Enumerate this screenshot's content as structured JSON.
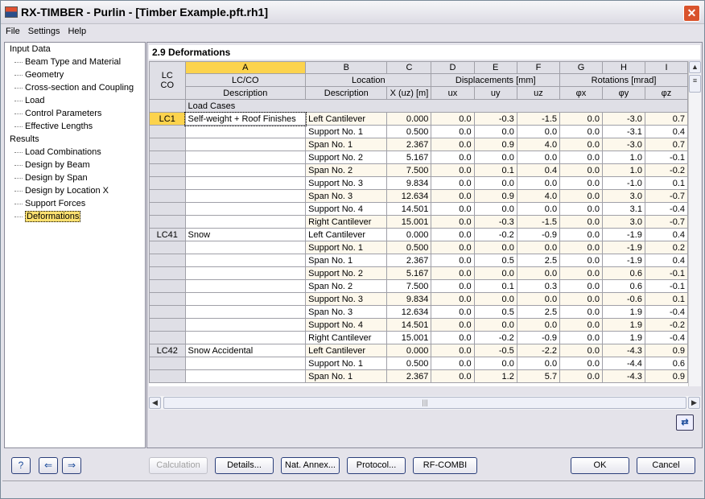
{
  "window": {
    "title": "RX-TIMBER - Purlin - [Timber Example.pft.rh1]"
  },
  "menu": [
    "File",
    "Settings",
    "Help"
  ],
  "tree": [
    {
      "label": "Input Data",
      "level": 0
    },
    {
      "label": "Beam Type and Material",
      "level": 1
    },
    {
      "label": "Geometry",
      "level": 1
    },
    {
      "label": "Cross-section and Coupling",
      "level": 1
    },
    {
      "label": "Load",
      "level": 1
    },
    {
      "label": "Control Parameters",
      "level": 1
    },
    {
      "label": "Effective Lengths",
      "level": 1
    },
    {
      "label": "Results",
      "level": 0
    },
    {
      "label": "Load Combinations",
      "level": 1
    },
    {
      "label": "Design by Beam",
      "level": 1
    },
    {
      "label": "Design by Span",
      "level": 1
    },
    {
      "label": "Design by Location X",
      "level": 1
    },
    {
      "label": "Support Forces",
      "level": 1
    },
    {
      "label": "Deformations",
      "level": 1,
      "selected": true
    }
  ],
  "section_title": "2.9 Deformations",
  "grid": {
    "col_letters": [
      "A",
      "B",
      "C",
      "D",
      "E",
      "F",
      "G",
      "H",
      "I"
    ],
    "rowhead_label1": "LC",
    "rowhead_label2": "CO",
    "group_lcco": "LC/CO",
    "group_location": "Location",
    "group_disp": "Displacements [mm]",
    "group_rot": "Rotations [mrad]",
    "sub_headers": [
      "Description",
      "Description",
      "X (uz) [m]",
      "ux",
      "uy",
      "uz",
      "φx",
      "φy",
      "φz"
    ],
    "section_row": "Load Cases",
    "rows": [
      [
        "LC1",
        "Self-weight + Roof Finishes",
        "Left Cantilever",
        "0.000",
        "0.0",
        "-0.3",
        "-1.5",
        "0.0",
        "-3.0",
        "0.7"
      ],
      [
        "",
        "",
        "Support No. 1",
        "0.500",
        "0.0",
        "0.0",
        "0.0",
        "0.0",
        "-3.1",
        "0.4"
      ],
      [
        "",
        "",
        "Span No. 1",
        "2.367",
        "0.0",
        "0.9",
        "4.0",
        "0.0",
        "-3.0",
        "0.7"
      ],
      [
        "",
        "",
        "Support No. 2",
        "5.167",
        "0.0",
        "0.0",
        "0.0",
        "0.0",
        "1.0",
        "-0.1"
      ],
      [
        "",
        "",
        "Span No. 2",
        "7.500",
        "0.0",
        "0.1",
        "0.4",
        "0.0",
        "1.0",
        "-0.2"
      ],
      [
        "",
        "",
        "Support No. 3",
        "9.834",
        "0.0",
        "0.0",
        "0.0",
        "0.0",
        "-1.0",
        "0.1"
      ],
      [
        "",
        "",
        "Span No. 3",
        "12.634",
        "0.0",
        "0.9",
        "4.0",
        "0.0",
        "3.0",
        "-0.7"
      ],
      [
        "",
        "",
        "Support No. 4",
        "14.501",
        "0.0",
        "0.0",
        "0.0",
        "0.0",
        "3.1",
        "-0.4"
      ],
      [
        "",
        "",
        "Right Cantilever",
        "15.001",
        "0.0",
        "-0.3",
        "-1.5",
        "0.0",
        "3.0",
        "-0.7"
      ],
      [
        "LC41",
        "Snow",
        "Left Cantilever",
        "0.000",
        "0.0",
        "-0.2",
        "-0.9",
        "0.0",
        "-1.9",
        "0.4"
      ],
      [
        "",
        "",
        "Support No. 1",
        "0.500",
        "0.0",
        "0.0",
        "0.0",
        "0.0",
        "-1.9",
        "0.2"
      ],
      [
        "",
        "",
        "Span No. 1",
        "2.367",
        "0.0",
        "0.5",
        "2.5",
        "0.0",
        "-1.9",
        "0.4"
      ],
      [
        "",
        "",
        "Support No. 2",
        "5.167",
        "0.0",
        "0.0",
        "0.0",
        "0.0",
        "0.6",
        "-0.1"
      ],
      [
        "",
        "",
        "Span No. 2",
        "7.500",
        "0.0",
        "0.1",
        "0.3",
        "0.0",
        "0.6",
        "-0.1"
      ],
      [
        "",
        "",
        "Support No. 3",
        "9.834",
        "0.0",
        "0.0",
        "0.0",
        "0.0",
        "-0.6",
        "0.1"
      ],
      [
        "",
        "",
        "Span No. 3",
        "12.634",
        "0.0",
        "0.5",
        "2.5",
        "0.0",
        "1.9",
        "-0.4"
      ],
      [
        "",
        "",
        "Support No. 4",
        "14.501",
        "0.0",
        "0.0",
        "0.0",
        "0.0",
        "1.9",
        "-0.2"
      ],
      [
        "",
        "",
        "Right Cantilever",
        "15.001",
        "0.0",
        "-0.2",
        "-0.9",
        "0.0",
        "1.9",
        "-0.4"
      ],
      [
        "LC42",
        "Snow Accidental",
        "Left Cantilever",
        "0.000",
        "0.0",
        "-0.5",
        "-2.2",
        "0.0",
        "-4.3",
        "0.9"
      ],
      [
        "",
        "",
        "Support No. 1",
        "0.500",
        "0.0",
        "0.0",
        "0.0",
        "0.0",
        "-4.4",
        "0.6"
      ],
      [
        "",
        "",
        "Span No. 1",
        "2.367",
        "0.0",
        "1.2",
        "5.7",
        "0.0",
        "-4.3",
        "0.9"
      ]
    ]
  },
  "buttons": {
    "calculation": "Calculation",
    "details": "Details...",
    "nat_annex": "Nat. Annex...",
    "protocol": "Protocol...",
    "rfcombi": "RF-COMBI",
    "ok": "OK",
    "cancel": "Cancel"
  },
  "colors": {
    "selected": "#fcd34d",
    "row_alt": "#fdf8ec",
    "header": "#dfdfe6"
  }
}
